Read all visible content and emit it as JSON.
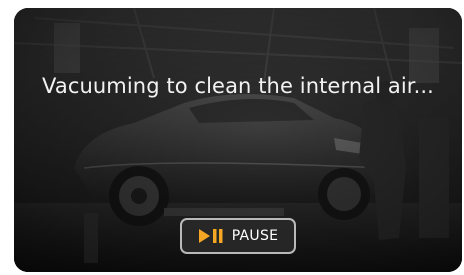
{
  "status": {
    "message": "Vacuuming to clean the internal air..."
  },
  "controls": {
    "pause_label": "PAUSE",
    "pause_icon": "play-pause-icon",
    "accent_color": "#f5a623"
  },
  "background": {
    "scene": "car-workshop-photo"
  }
}
